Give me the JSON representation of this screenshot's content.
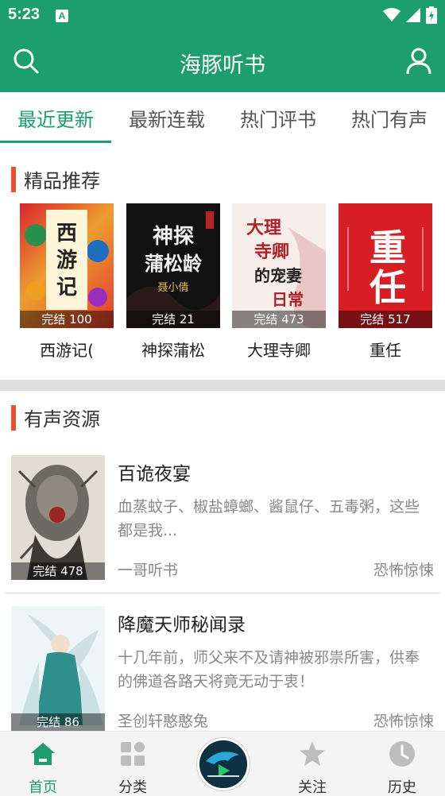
{
  "status_bar": {
    "time": "5:23",
    "notification_icon": "A"
  },
  "app_bar": {
    "title": "海豚听书",
    "left_icon": "search-icon",
    "right_icon": "user-icon"
  },
  "tabs": [
    {
      "label": "最近更新",
      "active": true
    },
    {
      "label": "最新连载",
      "active": false
    },
    {
      "label": "热门评书",
      "active": false
    },
    {
      "label": "热门有声",
      "active": false
    }
  ],
  "featured": {
    "title": "精品推荐",
    "books": [
      {
        "title": "西游记(",
        "badge": "完结 100",
        "cover_text": "西游记"
      },
      {
        "title": "神探蒲松",
        "badge": "完结 21",
        "cover_text": "神探蒲松龄",
        "cover_author": "聂小倩"
      },
      {
        "title": "大理寺卿",
        "badge": "完结 473",
        "cover_text": "大理寺卿的宠妻日常"
      },
      {
        "title": "重任",
        "badge": "完结 517",
        "cover_text": "重任"
      }
    ]
  },
  "audio": {
    "title": "有声资源",
    "items": [
      {
        "title": "百诡夜宴",
        "desc": "血蒸蚊子、椒盐蟑螂、酱鼠仔、五毒粥，这些都是我...",
        "author": "一哥听书",
        "category": "恐怖惊悚",
        "badge": "完结 478"
      },
      {
        "title": "降魔天师秘闻录",
        "desc": "十几年前，师父来不及请神被邪祟所害，供奉的佛道各路天将竟无动于衷！",
        "author": "圣创轩憨憨兔",
        "category": "恐怖惊悚",
        "badge": "完结 86"
      }
    ]
  },
  "bottom_nav": [
    {
      "label": "首页",
      "icon": "home-icon",
      "active": true
    },
    {
      "label": "分类",
      "icon": "category-icon",
      "active": false
    },
    {
      "label": "关注",
      "icon": "star-icon",
      "active": false
    },
    {
      "label": "历史",
      "icon": "clock-icon",
      "active": false
    }
  ],
  "colors": {
    "primary": "#1d9e6e",
    "accent_bar": "#e8522a",
    "background": "#ffffff",
    "band": "#dedede"
  }
}
